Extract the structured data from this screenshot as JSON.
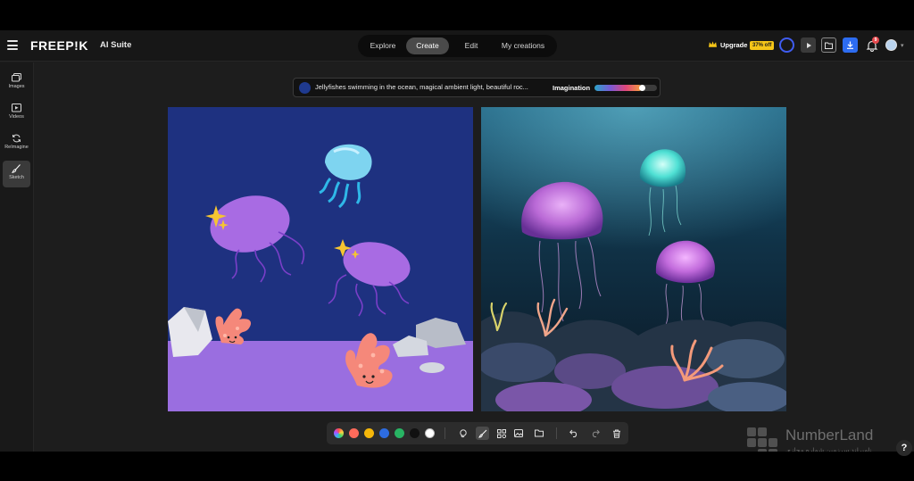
{
  "header": {
    "brand": "FREEP!K",
    "suite_label": "AI Suite",
    "nav_tabs": [
      {
        "label": "Explore",
        "active": false
      },
      {
        "label": "Create",
        "active": true
      },
      {
        "label": "Edit",
        "active": false
      },
      {
        "label": "My creations",
        "active": false
      }
    ],
    "upgrade_label": "Upgrade",
    "discount_badge": "37% off",
    "notification_count": "9"
  },
  "sidebar": {
    "items": [
      {
        "label": "Images",
        "icon": "images-icon",
        "active": false
      },
      {
        "label": "Videos",
        "icon": "video-icon",
        "active": false
      },
      {
        "label": "ReImagine",
        "icon": "refresh-icon",
        "active": false
      },
      {
        "label": "Sketch",
        "icon": "brush-icon",
        "active": true
      }
    ]
  },
  "prompt": {
    "text": "Jellyfishes swimming in the ocean, magical ambient light, beautiful roc...",
    "imagination_label": "Imagination",
    "imagination_level": 0.75
  },
  "toolbar": {
    "colors": [
      "#ff6b5b",
      "#f5b70a",
      "#2d6ce0",
      "#28b463",
      "#111111",
      "#ffffff"
    ],
    "tools": [
      "lasso-icon",
      "brush-icon",
      "shapes-icon",
      "image-icon",
      "folder-icon",
      "undo-icon",
      "redo-icon",
      "trash-icon"
    ]
  },
  "watermark": {
    "title": "NumberLand",
    "subtitle": "نامبرلند سرزمین شماره مجازی"
  },
  "help_label": "?",
  "colors": {
    "sketch_bg": "#1e3180",
    "sketch_ground": "#9a6ee0",
    "jelly_cyan": "#7ed4f0",
    "jelly_purple": "#a86be3",
    "coral": "#f5887a",
    "accent_blue": "#3f5cf0",
    "upgrade_yellow": "#f5c518"
  }
}
